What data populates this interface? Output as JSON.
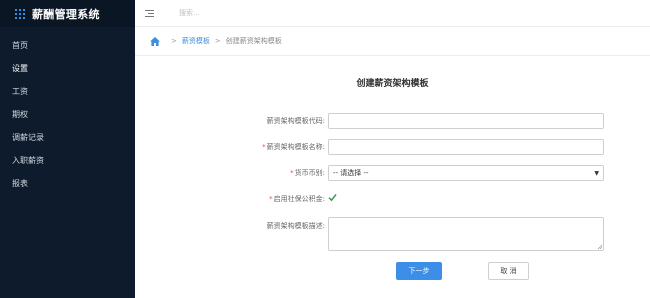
{
  "app": {
    "title": "薪酬管理系统"
  },
  "sidebar": {
    "items": [
      {
        "label": "首页"
      },
      {
        "label": "设置"
      },
      {
        "label": "工资"
      },
      {
        "label": "期权"
      },
      {
        "label": "调薪记录"
      },
      {
        "label": "入职薪资"
      },
      {
        "label": "报表"
      }
    ]
  },
  "topbar": {
    "search_placeholder": "搜索..."
  },
  "breadcrumb": {
    "separator": ">",
    "link": "薪资模板",
    "current": "创建薪资架构模板"
  },
  "form": {
    "title": "创建薪资架构模板",
    "code_label": "薪资架构模板代码:",
    "code_value": "",
    "name_label": "薪资架构模板名称:",
    "name_value": "",
    "currency_label": "货币币别:",
    "currency_value": "-- 请选择 --",
    "social_label": "启用社保公积金:",
    "social_checked": true,
    "desc_label": "薪资架构模板描述:",
    "desc_value": "",
    "required_mark": "*"
  },
  "buttons": {
    "next": "下一步",
    "cancel": "取 消"
  },
  "colors": {
    "sidebar": "#0e1b2c",
    "accent": "#3d8ee6",
    "required": "#e84c3d",
    "check": "#3a9b4c"
  }
}
